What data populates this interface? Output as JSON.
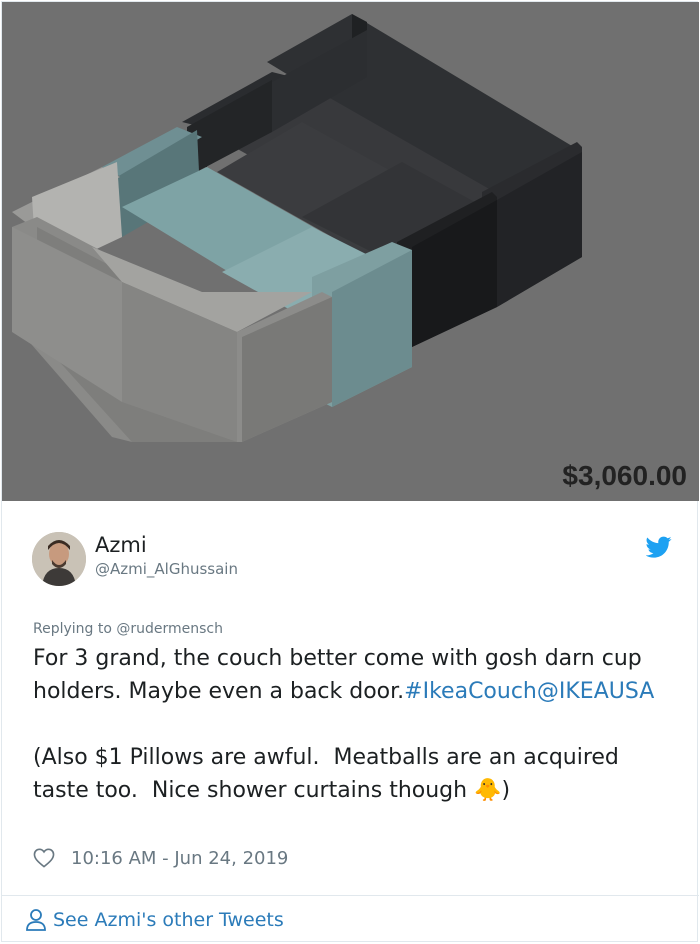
{
  "media": {
    "price": "$3,060.00"
  },
  "tweet": {
    "display_name": "Azmi",
    "handle": "@Azmi_AlGhussain",
    "replying_to": "Replying to @rudermensch",
    "text_line1": "For 3 grand, the couch better come with gosh darn cup holders. Maybe even a back door.",
    "hashtag": "#IkeaCouch",
    "mention": "@IKEAUSA",
    "text_line2": "(Also $1 Pillows are awful.  Meatballs are an acquired taste too.  Nice shower curtains though ",
    "emoji": "🐥",
    "text_end": ")",
    "timestamp": "10:16 AM - Jun 24, 2019"
  },
  "footer": {
    "label": "See Azmi's other Tweets"
  },
  "colors": {
    "link": "#2b7bb9",
    "muted": "#697882",
    "media_bg": "#707070"
  }
}
